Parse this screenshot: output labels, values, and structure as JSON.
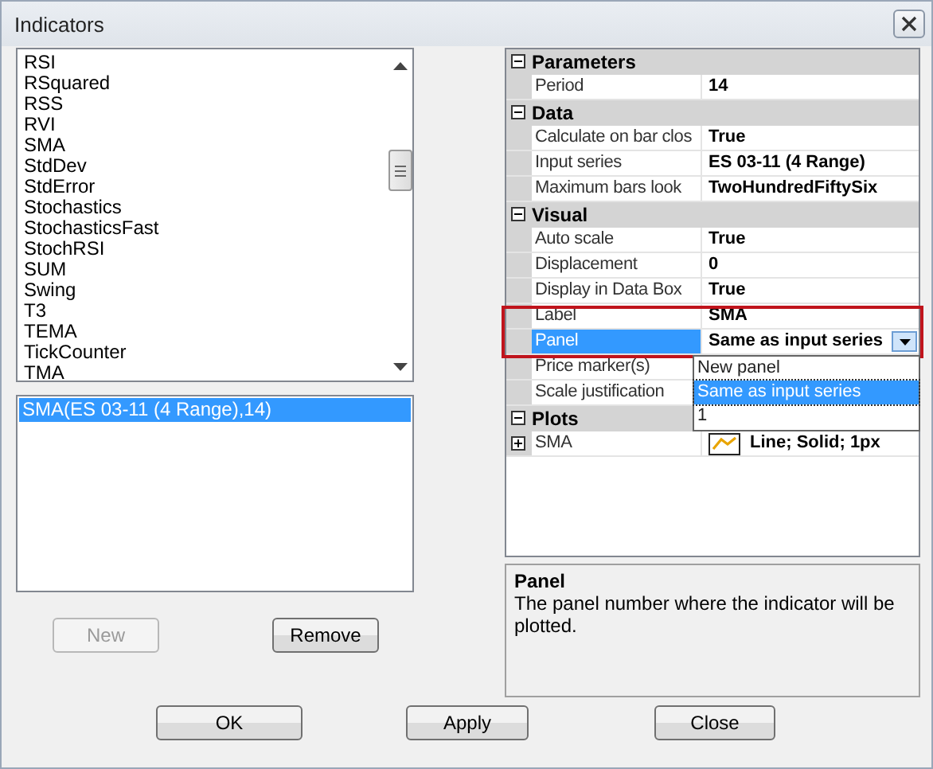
{
  "window": {
    "title": "Indicators"
  },
  "indicator_list": {
    "items": [
      "RSI",
      "RSquared",
      "RSS",
      "RVI",
      "SMA",
      "StdDev",
      "StdError",
      "Stochastics",
      "StochasticsFast",
      "StochRSI",
      "SUM",
      "Swing",
      "T3",
      "TEMA",
      "TickCounter",
      "TMA"
    ]
  },
  "applied_list": {
    "items": [
      {
        "label": "SMA(ES 03-11 (4 Range),14)",
        "selected": true
      }
    ]
  },
  "list_buttons": [
    {
      "label": "New",
      "disabled": true
    },
    {
      "label": "Remove",
      "disabled": false
    }
  ],
  "property_grid": {
    "categories": [
      {
        "name": "Parameters",
        "expanded": true,
        "properties": [
          {
            "name": "Period",
            "value": "14",
            "kind": "text",
            "selected": false
          }
        ]
      },
      {
        "name": "Data",
        "expanded": true,
        "properties": [
          {
            "name": "Calculate on bar clos",
            "value": "True",
            "kind": "text",
            "selected": false
          },
          {
            "name": "Input series",
            "value": "ES 03-11 (4 Range)",
            "kind": "text",
            "selected": false
          },
          {
            "name": "Maximum bars look",
            "value": "TwoHundredFiftySix",
            "kind": "text",
            "selected": false
          }
        ]
      },
      {
        "name": "Visual",
        "expanded": true,
        "properties": [
          {
            "name": "Auto scale",
            "value": "True",
            "kind": "text",
            "selected": false
          },
          {
            "name": "Displacement",
            "value": "0",
            "kind": "text",
            "selected": false
          },
          {
            "name": "Display in Data Box",
            "value": "True",
            "kind": "text",
            "selected": false
          },
          {
            "name": "Label",
            "value": "SMA",
            "kind": "text",
            "selected": false
          },
          {
            "name": "Panel",
            "value": "Same as input series",
            "kind": "dropdown",
            "selected": true
          },
          {
            "name": "Price marker(s)",
            "kind": "text",
            "selected": false
          },
          {
            "name": "Scale justification",
            "kind": "text",
            "selected": false
          }
        ]
      },
      {
        "name": "Plots",
        "expanded": true,
        "properties": [
          {
            "name": "SMA",
            "value": "Line; Solid; 1px",
            "kind": "plot",
            "expanded": false,
            "selected": false
          }
        ]
      }
    ]
  },
  "dropdown": {
    "options": [
      {
        "label": "New panel",
        "selected": false
      },
      {
        "label": "Same as input series",
        "selected": true
      },
      {
        "label": "1",
        "selected": false
      }
    ]
  },
  "description": {
    "title": "Panel",
    "text": "The panel number where the indicator will be plotted."
  },
  "buttons": [
    "OK",
    "Apply",
    "Close"
  ]
}
